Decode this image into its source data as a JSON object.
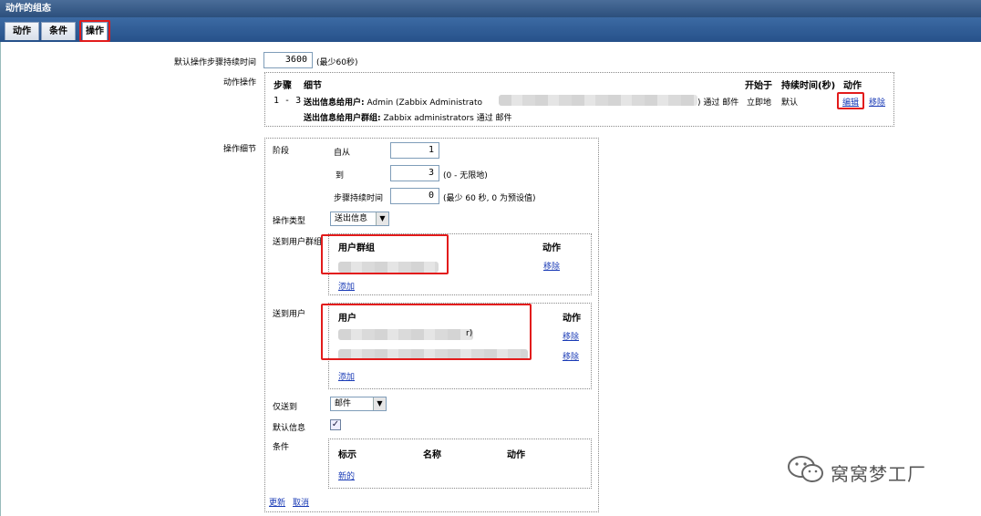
{
  "window": {
    "title": "动作的组态"
  },
  "tabs": [
    "动作",
    "条件",
    "操作"
  ],
  "default_step": {
    "label": "默认操作步骤持续时间",
    "value": "3600",
    "hint": "(最少60秒)"
  },
  "operations": {
    "label": "动作操作",
    "headers": {
      "steps": "步骤",
      "details": "细节",
      "start": "开始于",
      "duration": "持续时间(秒)",
      "action": "动作"
    },
    "row": {
      "steps": "1 - 3",
      "detail_line1_prefix": "送出信息给用户:",
      "detail_line1_text": "Admin (Zabbix Administrato",
      "detail_line1_suffix": ") 通过 邮件",
      "detail_line2_prefix": "送出信息给用户群组:",
      "detail_line2_text": "Zabbix administrators 通过 邮件",
      "start": "立即地",
      "duration": "默认",
      "edit": "编辑",
      "remove": "移除"
    }
  },
  "op_details": {
    "label": "操作细节",
    "stage_label": "阶段",
    "from_label": "自从",
    "from_value": "1",
    "to_label": "到",
    "to_value": "3",
    "to_hint": "(0 - 无限地)",
    "step_dur_label": "步骤持续时间",
    "step_dur_value": "0",
    "step_dur_hint": "(最少 60 秒, 0 为预设值)",
    "op_type_label": "操作类型",
    "op_type_value": "送出信息",
    "send_groups_label": "送到用户群组",
    "groups_header": "用户群组",
    "groups_action_header": "动作",
    "groups_remove": "移除",
    "groups_add": "添加",
    "send_users_label": "送到用户",
    "users_header": "用户",
    "users_action_header": "动作",
    "user1_tail": "r)",
    "users_remove1": "移除",
    "users_remove2": "移除",
    "users_add": "添加",
    "send_only_label": "仅送到",
    "send_only_value": "邮件",
    "default_msg_label": "默认信息",
    "default_msg_checked": "✓",
    "conditions_label": "条件",
    "cond_headers": {
      "label": "标示",
      "name": "名称",
      "action": "动作"
    },
    "cond_new": "新的",
    "update": "更新",
    "cancel": "取消"
  },
  "watermark": "窝窝梦工厂"
}
